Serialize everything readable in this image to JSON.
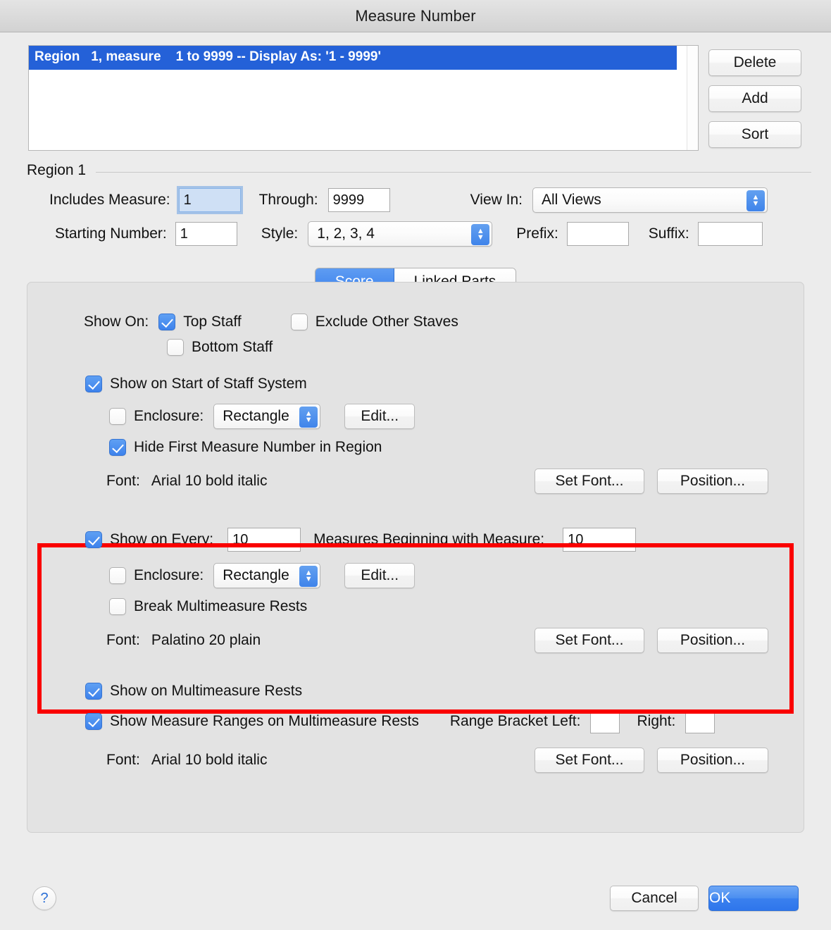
{
  "window": {
    "title": "Measure Number"
  },
  "region_list": {
    "items": [
      "Region   1, measure    1 to 9999 -- Display As: '1 - 9999'"
    ],
    "buttons": {
      "delete": "Delete",
      "add": "Add",
      "sort": "Sort"
    }
  },
  "region": {
    "group_label": "Region 1",
    "includes_measure_label": "Includes Measure:",
    "includes_measure_value": "1",
    "through_label": "Through:",
    "through_value": "9999",
    "view_in_label": "View In:",
    "view_in_value": "All Views",
    "starting_number_label": "Starting Number:",
    "starting_number_value": "1",
    "style_label": "Style:",
    "style_value": "1, 2, 3, 4",
    "prefix_label": "Prefix:",
    "prefix_value": "",
    "suffix_label": "Suffix:",
    "suffix_value": ""
  },
  "tabs": [
    {
      "label": "Score",
      "active": true
    },
    {
      "label": "Linked Parts",
      "active": false
    }
  ],
  "panel": {
    "show_on_label": "Show On:",
    "top_staff": {
      "label": "Top Staff",
      "checked": true
    },
    "exclude_other_staves": {
      "label": "Exclude Other Staves",
      "checked": false
    },
    "bottom_staff": {
      "label": "Bottom Staff",
      "checked": false
    },
    "start_of_staff_system": {
      "label": "Show on Start of Staff System",
      "checked": true,
      "enclosure": {
        "label": "Enclosure:",
        "checked": false,
        "value": "Rectangle",
        "edit_label": "Edit..."
      },
      "hide_first": {
        "label": "Hide First Measure Number in Region",
        "checked": true
      },
      "font_label": "Font:",
      "font_value": "Arial 10 bold italic",
      "set_font_label": "Set Font...",
      "position_label": "Position..."
    },
    "show_on_every": {
      "label": "Show on Every:",
      "checked": true,
      "every_value": "10",
      "middle_label": "Measures Beginning with Measure:",
      "beginning_value": "10",
      "enclosure": {
        "label": "Enclosure:",
        "checked": false,
        "value": "Rectangle",
        "edit_label": "Edit..."
      },
      "break_multimeasure": {
        "label": "Break Multimeasure Rests",
        "checked": false
      },
      "font_label": "Font:",
      "font_value": "Palatino 20 plain",
      "set_font_label": "Set Font...",
      "position_label": "Position..."
    },
    "multimeasure": {
      "show_on_multimeasure": {
        "label": "Show on Multimeasure Rests",
        "checked": true
      },
      "show_ranges": {
        "label": "Show Measure Ranges on Multimeasure Rests",
        "checked": true
      },
      "range_bracket_left_label": "Range Bracket Left:",
      "range_bracket_left_value": "",
      "range_bracket_right_label": "Right:",
      "range_bracket_right_value": "",
      "font_label": "Font:",
      "font_value": "Arial 10 bold italic",
      "set_font_label": "Set Font...",
      "position_label": "Position..."
    }
  },
  "footer": {
    "help_label": "?",
    "cancel_label": "Cancel",
    "ok_label": "OK"
  },
  "colors": {
    "accent_blue": "#2461d8",
    "checkbox_blue": "#3d82ec",
    "highlight_red": "#fa0000",
    "window_bg": "#ececec",
    "panel_bg": "#e3e3e3"
  }
}
